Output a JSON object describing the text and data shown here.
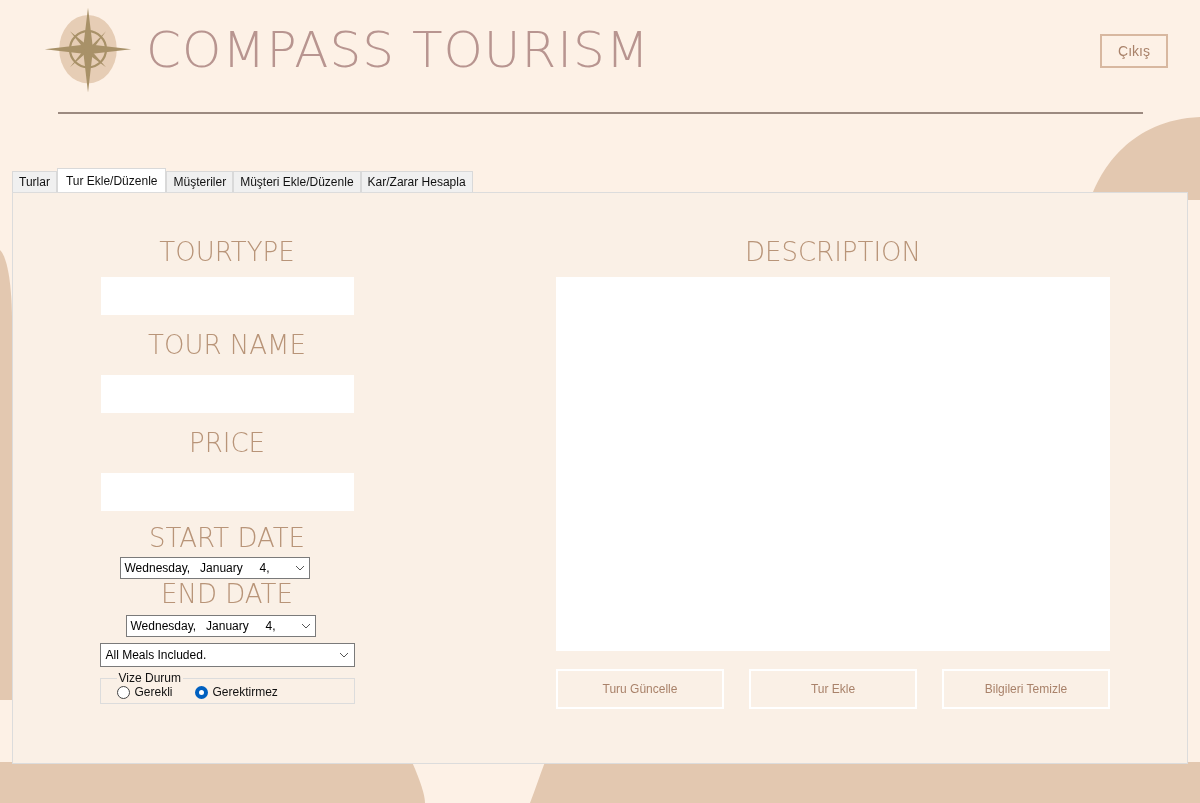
{
  "header": {
    "title": "COMPASS TOURISM",
    "exit_button": "Çıkış"
  },
  "tabs": [
    {
      "label": "Turlar",
      "selected": false
    },
    {
      "label": "Tur Ekle/Düzenle",
      "selected": true
    },
    {
      "label": "Müşteriler",
      "selected": false
    },
    {
      "label": "Müşteri Ekle/Düzenle",
      "selected": false
    },
    {
      "label": "Kar/Zarar Hesapla",
      "selected": false
    }
  ],
  "form": {
    "tourtype_label": "TOURTYPE",
    "tour_name_label": "TOUR NAME",
    "price_label": "PRICE",
    "start_date_label": "START DATE",
    "start_date": "Wednesday,   January     4,",
    "end_date_label": "END DATE",
    "end_date": "Wednesday,   January     4,",
    "meals": "All Meals Included.",
    "visa": {
      "legend": "Vize Durum",
      "options": [
        {
          "label": "Gerekli",
          "selected": false
        },
        {
          "label": "Gerektirmez",
          "selected": true
        }
      ]
    }
  },
  "description": {
    "label": "DESCRIPTION"
  },
  "buttons": [
    "Turu Güncelle",
    "Tur Ekle",
    "Bilgileri Temizle"
  ]
}
